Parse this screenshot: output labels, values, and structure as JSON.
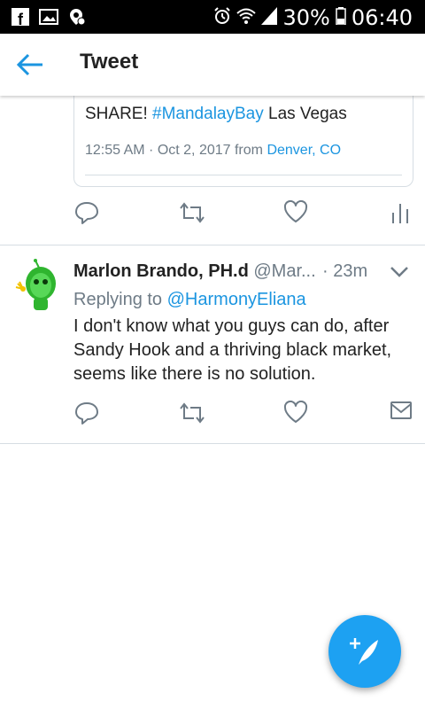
{
  "status_bar": {
    "battery_percent": "30%",
    "time": "06:40",
    "icons": [
      "facebook-icon",
      "image-icon",
      "location-icon",
      "alarm-icon",
      "wifi-icon",
      "signal-icon",
      "battery-icon"
    ]
  },
  "app_bar": {
    "title": "Tweet",
    "back_icon": "arrow-left-icon"
  },
  "quoted_tweet": {
    "text_prefix": "SHARE!",
    "hashtag": "#MandalayBay",
    "text_suffix": "Las Vegas",
    "meta_time": "12:55 AM · Oct 2, 2017 from",
    "meta_place": "Denver, CO"
  },
  "reply": {
    "author_name": "Marlon Brando, PH.d",
    "author_handle": "@Mar...",
    "separator": "·",
    "time": "23m",
    "replying_to_label": "Replying to",
    "replying_to_mention": "@HarmonyEliana",
    "text": "I don't know what you guys can do, after Sandy Hook and a thriving black market, seems like there is no solution."
  },
  "colors": {
    "accent": "#1b95e0",
    "fab": "#1da1f2",
    "divider": "#d6dde3",
    "secondary_text": "#6e7b86"
  }
}
